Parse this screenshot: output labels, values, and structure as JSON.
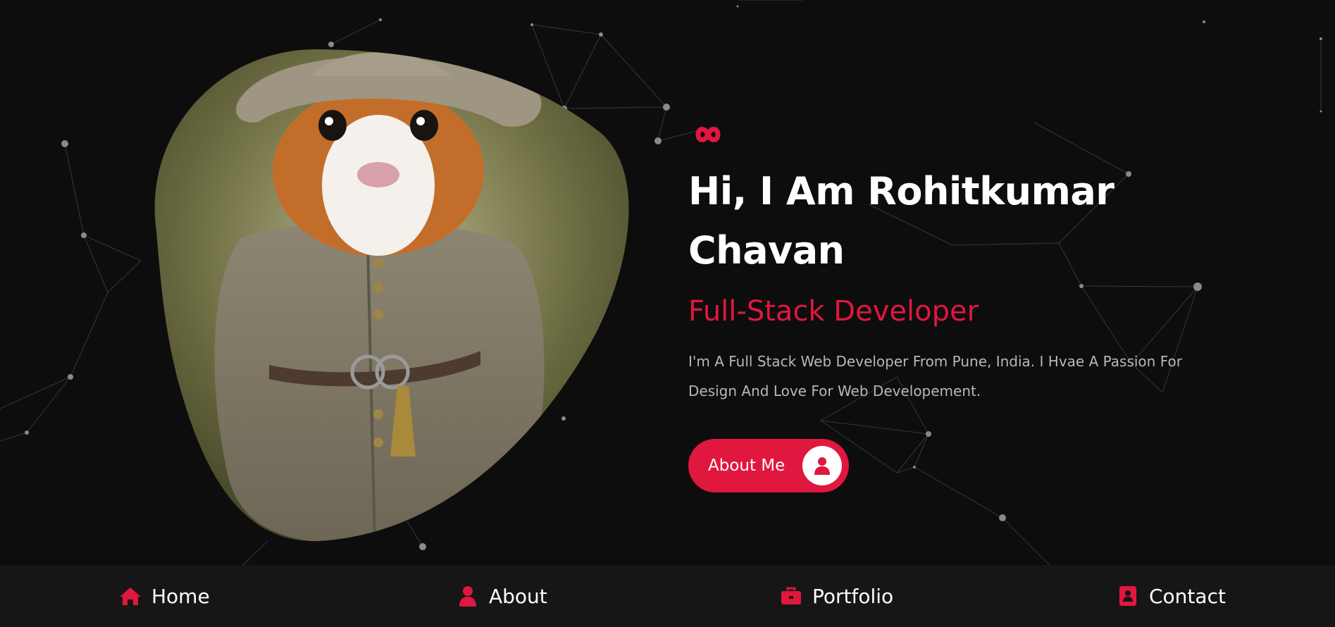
{
  "colors": {
    "background": "#0d0d0d",
    "accent": "#e0173f",
    "nav_background": "#161616",
    "text_primary": "#ffffff",
    "text_muted": "#b8b8b8"
  },
  "hero": {
    "logo_icon": "infinity-icon",
    "title": "Hi, I Am Rohitkumar Chavan",
    "role": "Full-Stack Developer",
    "description": "I'm A Full Stack Web Developer From Pune, India. I Hvae A Passion For Design And Love For Web Developement.",
    "portrait_subject": "guinea pig in a wizard hat and cloak",
    "about_button": {
      "label": "About Me",
      "icon": "user-icon"
    }
  },
  "nav": {
    "items": [
      {
        "label": "Home",
        "icon": "home-icon"
      },
      {
        "label": "About",
        "icon": "user-icon"
      },
      {
        "label": "Portfolio",
        "icon": "briefcase-icon"
      },
      {
        "label": "Contact",
        "icon": "address-book-icon"
      }
    ]
  }
}
